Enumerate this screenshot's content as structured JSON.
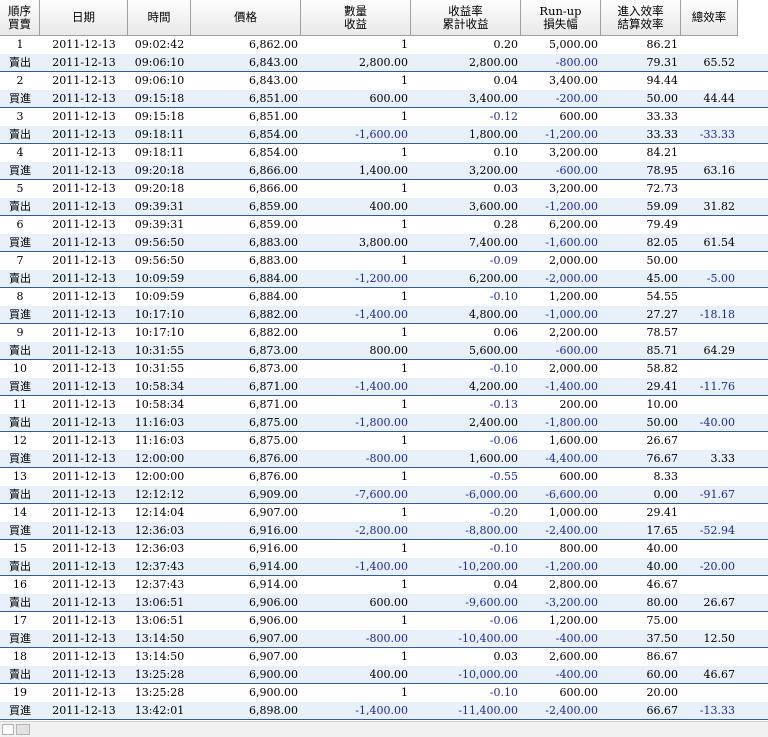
{
  "header": {
    "seq_line1": "順序",
    "seq_line2": "買賣",
    "date": "日期",
    "time": "時間",
    "price": "價格",
    "qty_line1": "數量",
    "qty_line2": "收益",
    "ret_line1": "收益率",
    "ret_line2": "累計收益",
    "run_line1": "Run-up",
    "run_line2": "損失幅",
    "eff_line1": "進入效率",
    "eff_line2": "結算效率",
    "total": "總效率"
  },
  "trades": [
    {
      "seq": "1",
      "entry": {
        "date": "2011-12-13",
        "time": "09:02:42",
        "price": "6,862.00",
        "qty": "1",
        "ret": "0.20",
        "runup": "5,000.00",
        "eff": "86.21"
      },
      "exit": {
        "side": "賣出",
        "date": "2011-12-13",
        "time": "09:06:10",
        "price": "6,843.00",
        "profit": "2,800.00",
        "cum": "2,800.00",
        "loss": "-800.00",
        "eff": "79.31",
        "total": "65.52"
      }
    },
    {
      "seq": "2",
      "entry": {
        "date": "2011-12-13",
        "time": "09:06:10",
        "price": "6,843.00",
        "qty": "1",
        "ret": "0.04",
        "runup": "3,400.00",
        "eff": "94.44"
      },
      "exit": {
        "side": "買進",
        "date": "2011-12-13",
        "time": "09:15:18",
        "price": "6,851.00",
        "profit": "600.00",
        "cum": "3,400.00",
        "loss": "-200.00",
        "eff": "50.00",
        "total": "44.44"
      }
    },
    {
      "seq": "3",
      "entry": {
        "date": "2011-12-13",
        "time": "09:15:18",
        "price": "6,851.00",
        "qty": "1",
        "ret": "-0.12",
        "runup": "600.00",
        "eff": "33.33"
      },
      "exit": {
        "side": "賣出",
        "date": "2011-12-13",
        "time": "09:18:11",
        "price": "6,854.00",
        "profit": "-1,600.00",
        "cum": "1,800.00",
        "loss": "-1,200.00",
        "eff": "33.33",
        "total": "-33.33"
      }
    },
    {
      "seq": "4",
      "entry": {
        "date": "2011-12-13",
        "time": "09:18:11",
        "price": "6,854.00",
        "qty": "1",
        "ret": "0.10",
        "runup": "3,200.00",
        "eff": "84.21"
      },
      "exit": {
        "side": "買進",
        "date": "2011-12-13",
        "time": "09:20:18",
        "price": "6,866.00",
        "profit": "1,400.00",
        "cum": "3,200.00",
        "loss": "-600.00",
        "eff": "78.95",
        "total": "63.16"
      }
    },
    {
      "seq": "5",
      "entry": {
        "date": "2011-12-13",
        "time": "09:20:18",
        "price": "6,866.00",
        "qty": "1",
        "ret": "0.03",
        "runup": "3,200.00",
        "eff": "72.73"
      },
      "exit": {
        "side": "賣出",
        "date": "2011-12-13",
        "time": "09:39:31",
        "price": "6,859.00",
        "profit": "400.00",
        "cum": "3,600.00",
        "loss": "-1,200.00",
        "eff": "59.09",
        "total": "31.82"
      }
    },
    {
      "seq": "6",
      "entry": {
        "date": "2011-12-13",
        "time": "09:39:31",
        "price": "6,859.00",
        "qty": "1",
        "ret": "0.28",
        "runup": "6,200.00",
        "eff": "79.49"
      },
      "exit": {
        "side": "買進",
        "date": "2011-12-13",
        "time": "09:56:50",
        "price": "6,883.00",
        "profit": "3,800.00",
        "cum": "7,400.00",
        "loss": "-1,600.00",
        "eff": "82.05",
        "total": "61.54"
      }
    },
    {
      "seq": "7",
      "entry": {
        "date": "2011-12-13",
        "time": "09:56:50",
        "price": "6,883.00",
        "qty": "1",
        "ret": "-0.09",
        "runup": "2,000.00",
        "eff": "50.00"
      },
      "exit": {
        "side": "賣出",
        "date": "2011-12-13",
        "time": "10:09:59",
        "price": "6,884.00",
        "profit": "-1,200.00",
        "cum": "6,200.00",
        "loss": "-2,000.00",
        "eff": "45.00",
        "total": "-5.00"
      }
    },
    {
      "seq": "8",
      "entry": {
        "date": "2011-12-13",
        "time": "10:09:59",
        "price": "6,884.00",
        "qty": "1",
        "ret": "-0.10",
        "runup": "1,200.00",
        "eff": "54.55"
      },
      "exit": {
        "side": "買進",
        "date": "2011-12-13",
        "time": "10:17:10",
        "price": "6,882.00",
        "profit": "-1,400.00",
        "cum": "4,800.00",
        "loss": "-1,000.00",
        "eff": "27.27",
        "total": "-18.18"
      }
    },
    {
      "seq": "9",
      "entry": {
        "date": "2011-12-13",
        "time": "10:17:10",
        "price": "6,882.00",
        "qty": "1",
        "ret": "0.06",
        "runup": "2,200.00",
        "eff": "78.57"
      },
      "exit": {
        "side": "賣出",
        "date": "2011-12-13",
        "time": "10:31:55",
        "price": "6,873.00",
        "profit": "800.00",
        "cum": "5,600.00",
        "loss": "-600.00",
        "eff": "85.71",
        "total": "64.29"
      }
    },
    {
      "seq": "10",
      "entry": {
        "date": "2011-12-13",
        "time": "10:31:55",
        "price": "6,873.00",
        "qty": "1",
        "ret": "-0.10",
        "runup": "2,000.00",
        "eff": "58.82"
      },
      "exit": {
        "side": "買進",
        "date": "2011-12-13",
        "time": "10:58:34",
        "price": "6,871.00",
        "profit": "-1,400.00",
        "cum": "4,200.00",
        "loss": "-1,400.00",
        "eff": "29.41",
        "total": "-11.76"
      }
    },
    {
      "seq": "11",
      "entry": {
        "date": "2011-12-13",
        "time": "10:58:34",
        "price": "6,871.00",
        "qty": "1",
        "ret": "-0.13",
        "runup": "200.00",
        "eff": "10.00"
      },
      "exit": {
        "side": "賣出",
        "date": "2011-12-13",
        "time": "11:16:03",
        "price": "6,875.00",
        "profit": "-1,800.00",
        "cum": "2,400.00",
        "loss": "-1,800.00",
        "eff": "50.00",
        "total": "-40.00"
      }
    },
    {
      "seq": "12",
      "entry": {
        "date": "2011-12-13",
        "time": "11:16:03",
        "price": "6,875.00",
        "qty": "1",
        "ret": "-0.06",
        "runup": "1,600.00",
        "eff": "26.67"
      },
      "exit": {
        "side": "買進",
        "date": "2011-12-13",
        "time": "12:00:00",
        "price": "6,876.00",
        "profit": "-800.00",
        "cum": "1,600.00",
        "loss": "-4,400.00",
        "eff": "76.67",
        "total": "3.33"
      }
    },
    {
      "seq": "13",
      "entry": {
        "date": "2011-12-13",
        "time": "12:00:00",
        "price": "6,876.00",
        "qty": "1",
        "ret": "-0.55",
        "runup": "600.00",
        "eff": "8.33"
      },
      "exit": {
        "side": "賣出",
        "date": "2011-12-13",
        "time": "12:12:12",
        "price": "6,909.00",
        "profit": "-7,600.00",
        "cum": "-6,000.00",
        "loss": "-6,600.00",
        "eff": "0.00",
        "total": "-91.67"
      }
    },
    {
      "seq": "14",
      "entry": {
        "date": "2011-12-13",
        "time": "12:14:04",
        "price": "6,907.00",
        "qty": "1",
        "ret": "-0.20",
        "runup": "1,000.00",
        "eff": "29.41"
      },
      "exit": {
        "side": "買進",
        "date": "2011-12-13",
        "time": "12:36:03",
        "price": "6,916.00",
        "profit": "-2,800.00",
        "cum": "-8,800.00",
        "loss": "-2,400.00",
        "eff": "17.65",
        "total": "-52.94"
      }
    },
    {
      "seq": "15",
      "entry": {
        "date": "2011-12-13",
        "time": "12:36:03",
        "price": "6,916.00",
        "qty": "1",
        "ret": "-0.10",
        "runup": "800.00",
        "eff": "40.00"
      },
      "exit": {
        "side": "賣出",
        "date": "2011-12-13",
        "time": "12:37:43",
        "price": "6,914.00",
        "profit": "-1,400.00",
        "cum": "-10,200.00",
        "loss": "-1,200.00",
        "eff": "40.00",
        "total": "-20.00"
      }
    },
    {
      "seq": "16",
      "entry": {
        "date": "2011-12-13",
        "time": "12:37:43",
        "price": "6,914.00",
        "qty": "1",
        "ret": "0.04",
        "runup": "2,800.00",
        "eff": "46.67"
      },
      "exit": {
        "side": "賣出",
        "date": "2011-12-13",
        "time": "13:06:51",
        "price": "6,906.00",
        "profit": "600.00",
        "cum": "-9,600.00",
        "loss": "-3,200.00",
        "eff": "80.00",
        "total": "26.67"
      }
    },
    {
      "seq": "17",
      "entry": {
        "date": "2011-12-13",
        "time": "13:06:51",
        "price": "6,906.00",
        "qty": "1",
        "ret": "-0.06",
        "runup": "1,200.00",
        "eff": "75.00"
      },
      "exit": {
        "side": "買進",
        "date": "2011-12-13",
        "time": "13:14:50",
        "price": "6,907.00",
        "profit": "-800.00",
        "cum": "-10,400.00",
        "loss": "-400.00",
        "eff": "37.50",
        "total": "12.50"
      }
    },
    {
      "seq": "18",
      "entry": {
        "date": "2011-12-13",
        "time": "13:14:50",
        "price": "6,907.00",
        "qty": "1",
        "ret": "0.03",
        "runup": "2,600.00",
        "eff": "86.67"
      },
      "exit": {
        "side": "賣出",
        "date": "2011-12-13",
        "time": "13:25:28",
        "price": "6,900.00",
        "profit": "400.00",
        "cum": "-10,000.00",
        "loss": "-400.00",
        "eff": "60.00",
        "total": "46.67"
      }
    },
    {
      "seq": "19",
      "entry": {
        "date": "2011-12-13",
        "time": "13:25:28",
        "price": "6,900.00",
        "qty": "1",
        "ret": "-0.10",
        "runup": "600.00",
        "eff": "20.00"
      },
      "exit": {
        "side": "買進",
        "date": "2011-12-13",
        "time": "13:42:01",
        "price": "6,898.00",
        "profit": "-1,400.00",
        "cum": "-11,400.00",
        "loss": "-2,400.00",
        "eff": "66.67",
        "total": "-13.33"
      }
    }
  ],
  "colors": {
    "negative": "#1e2c9e",
    "exit_row_bg": "#e8f0fa",
    "trade_separator": "#2f5c9a"
  }
}
